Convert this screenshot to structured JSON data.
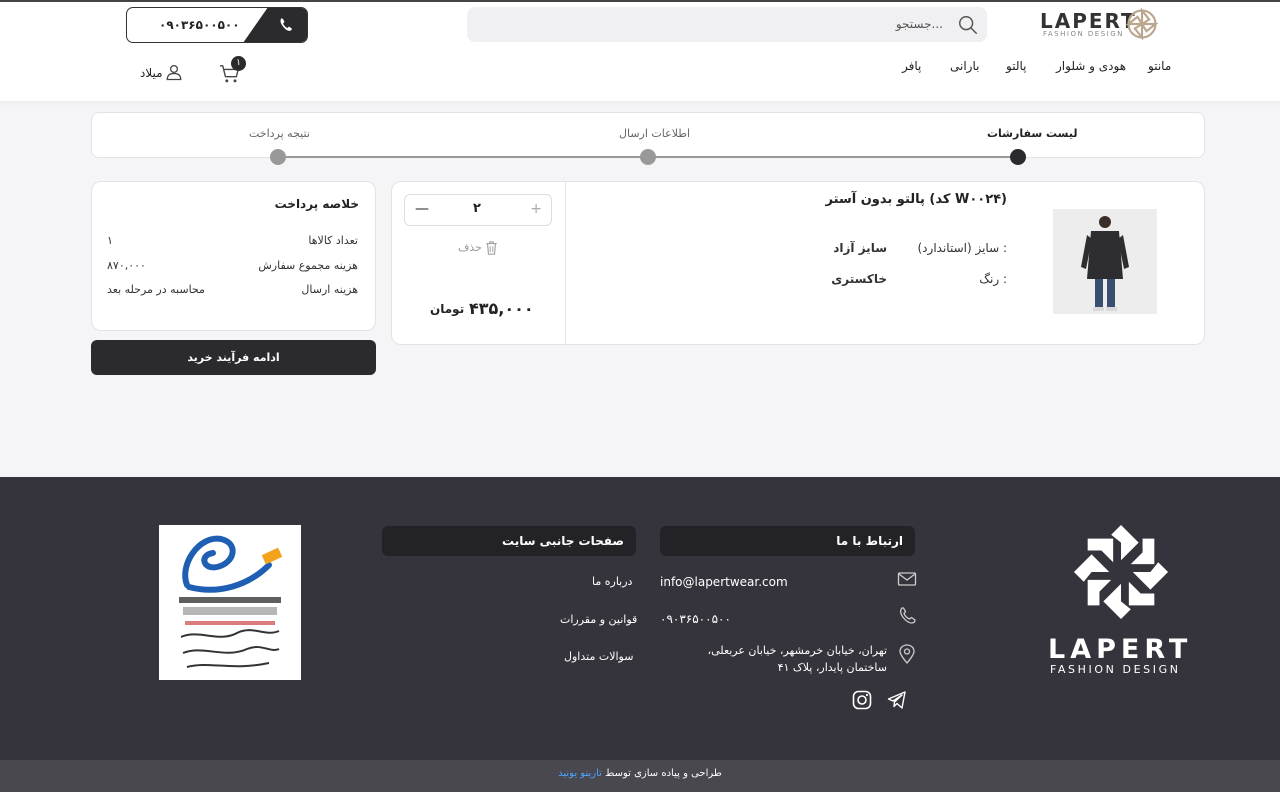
{
  "header": {
    "brand": "LAPERT",
    "brand_sub": "FASHION DESIGN",
    "search_placeholder": "جستجو...",
    "phone": "۰۹۰۳۶۵۰۰۵۰۰",
    "nav": [
      "مانتو",
      "هودی و شلوار",
      "پالتو",
      "بارانی",
      "پافر"
    ],
    "cart_count": "۱",
    "user_name": "میلاد"
  },
  "steps": {
    "items": [
      "لیست سفارشات",
      "اطلاعات ارسال",
      "نتیجه پرداخت"
    ],
    "active_index": 0
  },
  "product": {
    "title": "پالتو بدون آستر (کد W۰۰۲۴)",
    "size_label": "سایز (استاندارد) :",
    "size_value": "سایز آزاد",
    "color_label": "رنگ :",
    "color_value": "خاکستری",
    "quantity": "۲",
    "delete_label": "حذف",
    "price": "۴۳۵,۰۰۰",
    "currency": "تومان"
  },
  "summary": {
    "title": "خلاصه پرداخت",
    "rows": [
      {
        "label": "تعداد کالاها",
        "value": "۱"
      },
      {
        "label": "هزینه مجموع سفارش",
        "value": "۸۷۰,۰۰۰"
      },
      {
        "label": "هزینه ارسال",
        "value": "محاسبه در مرحله بعد"
      }
    ],
    "continue_label": "ادامه فرآیند خرید"
  },
  "footer": {
    "contact_title": "ارتباط با ما",
    "email": "info@lapertwear.com",
    "phone": "۰۹۰۳۶۵۰۰۵۰۰",
    "address": "تهران، خیابان خرمشهر، خیابان عربعلی، ساختمان پایدار، پلاک ۴۱",
    "pages_title": "صفحات جانبی سایت",
    "pages": [
      "درباره ما",
      "قوانین و مقررات",
      "سوالات متداول"
    ],
    "brand": "LAPERT",
    "brand_sub": "FASHION DESIGN",
    "credit_text": "طراحی و پیاده سازی توسط",
    "credit_link": "تارینو یونید"
  },
  "colors": {
    "dark": "#2b2b2e",
    "footer_bg": "#35343c",
    "accent_link": "#4aa3ff",
    "step_inactive": "#999999"
  }
}
